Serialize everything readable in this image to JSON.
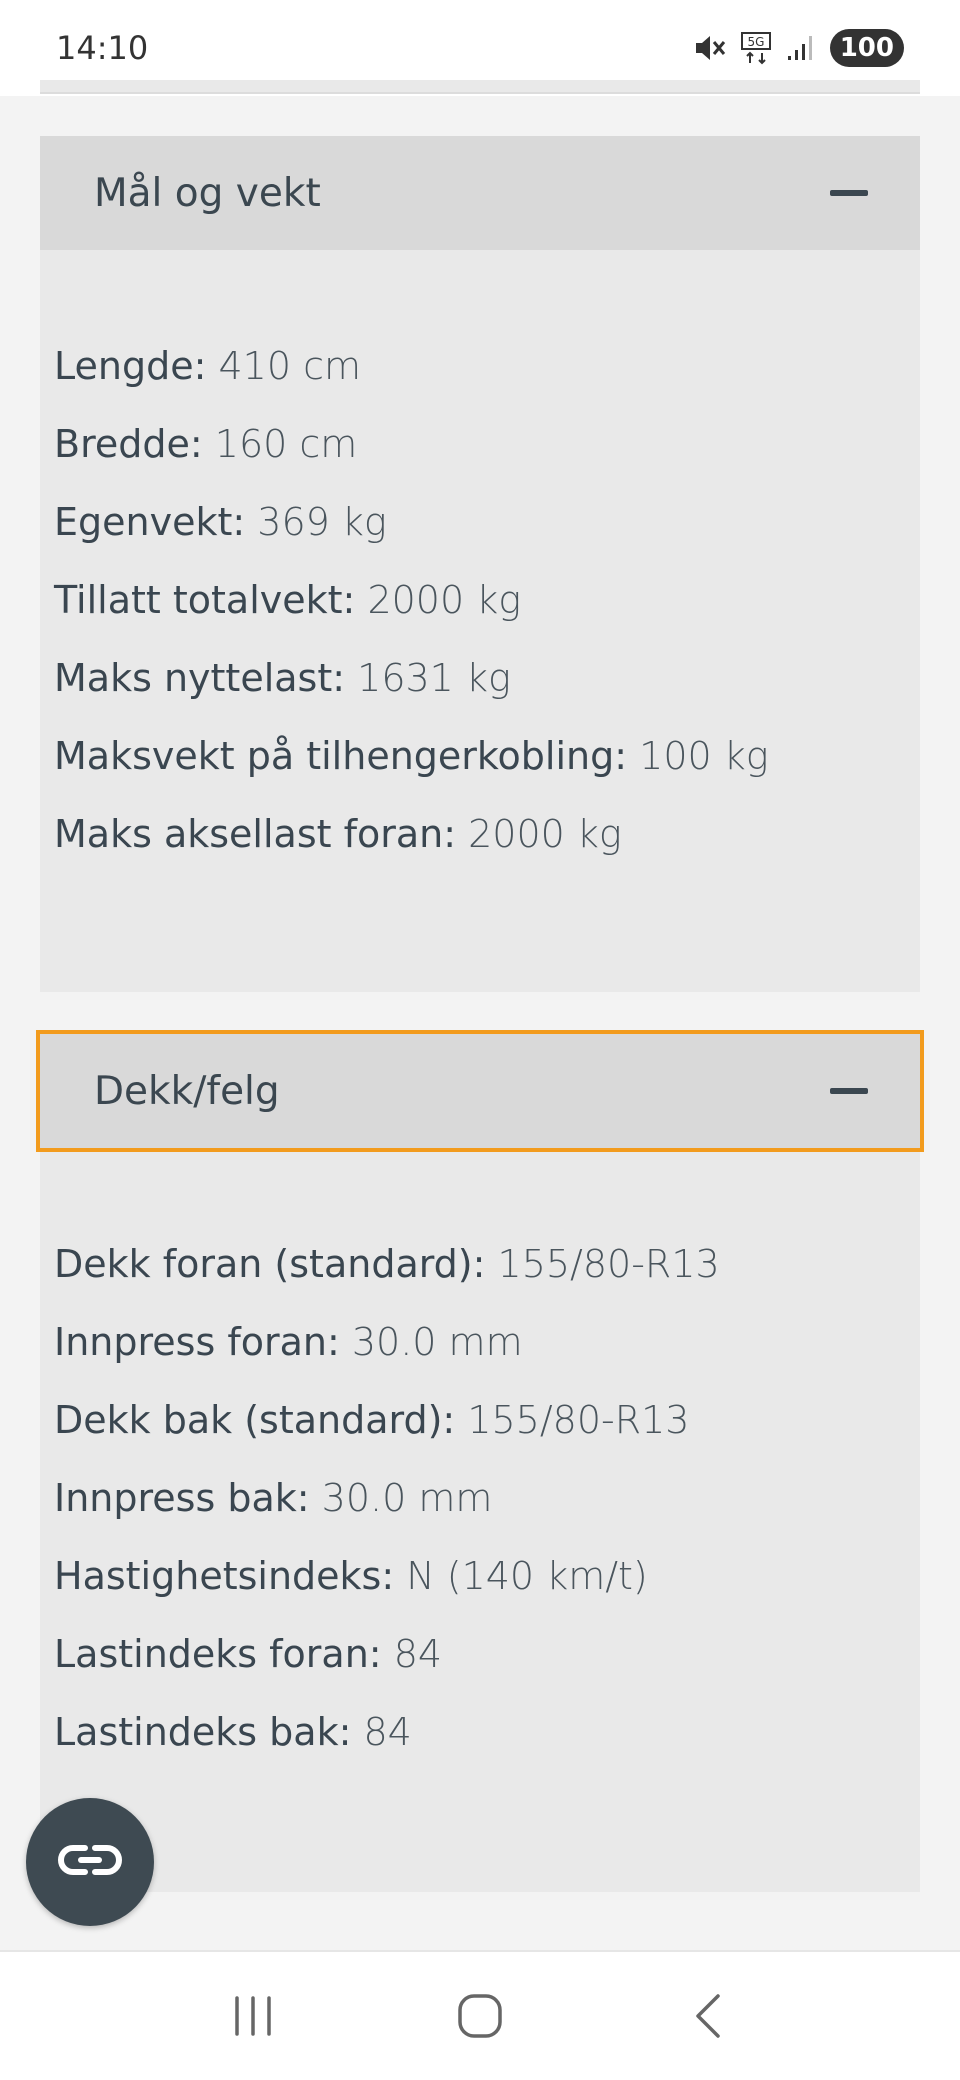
{
  "status_bar": {
    "time": "14:10",
    "icons": [
      "mute-icon",
      "5g-icon",
      "signal-icon"
    ],
    "battery": "100"
  },
  "sections": [
    {
      "title": "Mål og vekt",
      "expanded": true,
      "rows": [
        {
          "label": "Lengde:",
          "value": "410 cm"
        },
        {
          "label": "Bredde:",
          "value": "160 cm"
        },
        {
          "label": "Egenvekt:",
          "value": "369 kg"
        },
        {
          "label": "Tillatt totalvekt:",
          "value": "2000 kg"
        },
        {
          "label": "Maks nyttelast:",
          "value": "1631 kg"
        },
        {
          "label": "Maksvekt på tilhengerkobling:",
          "value": "100 kg"
        },
        {
          "label": "Maks aksellast foran:",
          "value": "2000 kg"
        }
      ]
    },
    {
      "title": "Dekk/felg",
      "expanded": true,
      "focused": true,
      "rows": [
        {
          "label": "Dekk foran (standard):",
          "value": "155/80-R13"
        },
        {
          "label": "Innpress foran:",
          "value": "30.0 mm"
        },
        {
          "label": "Dekk bak (standard):",
          "value": "155/80-R13"
        },
        {
          "label": "Innpress bak:",
          "value": "30.0 mm"
        },
        {
          "label": "Hastighetsindeks:",
          "value": "N (140 km/t)"
        },
        {
          "label": "Lastindeks foran:",
          "value": "84"
        },
        {
          "label": "Lastindeks bak:",
          "value": "84"
        }
      ]
    }
  ],
  "fab": {
    "icon": "link-icon"
  },
  "nav_bar": {
    "buttons": [
      "recent-apps-icon",
      "home-icon",
      "back-icon"
    ]
  },
  "colors": {
    "focus_outline": "#f29b1d",
    "header_bg": "#d9d9d9",
    "body_bg": "#e9e9e9",
    "text": "#3b4750"
  }
}
